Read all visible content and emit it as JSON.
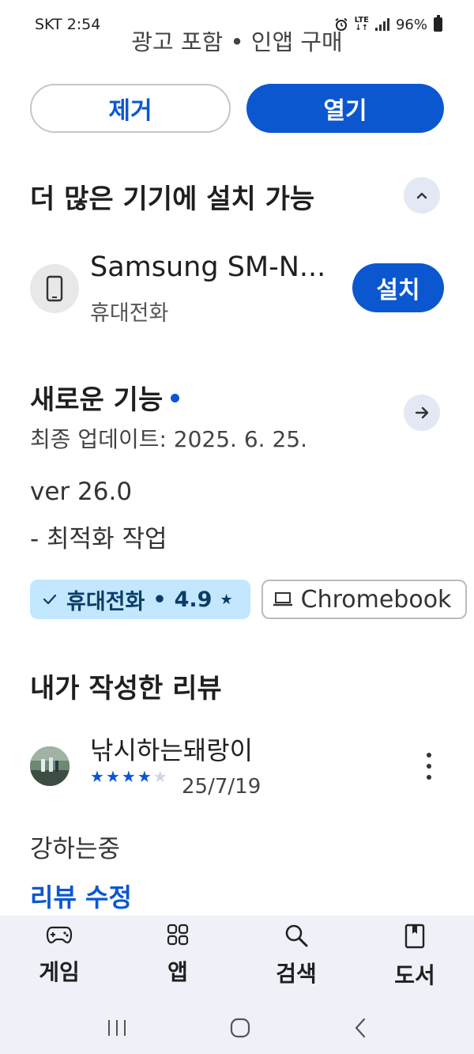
{
  "status_bar": {
    "carrier_time": "SKT 2:54",
    "network": "LTE",
    "battery": "96%"
  },
  "top": {
    "clipped_text": "광고 포함 • 인앱 구매"
  },
  "actions": {
    "uninstall_label": "제거",
    "open_label": "열기"
  },
  "more_devices": {
    "title": "더 많은 기기에 설치 가능",
    "device_name": "Samsung SM-N...",
    "device_type": "휴대전화",
    "install_label": "설치"
  },
  "whats_new": {
    "title": "새로운 기능",
    "last_updated": "최종 업데이트: 2025. 6. 25.",
    "version": "ver 26.0",
    "note": "- 최적화 작업"
  },
  "chips": {
    "phone": {
      "label": "휴대전화",
      "rating": "4.9"
    },
    "chromebook": {
      "label": "Chromebook"
    }
  },
  "my_review": {
    "title": "내가 작성한 리뷰",
    "reviewer": "낚시하는돼랑이",
    "rating": 4,
    "max_rating": 5,
    "date": "25/7/19",
    "text": "강하는중",
    "edit_label": "리뷰 수정"
  },
  "bottom_nav": [
    {
      "label": "게임",
      "icon": "gamepad-icon"
    },
    {
      "label": "앱",
      "icon": "apps-grid-icon"
    },
    {
      "label": "검색",
      "icon": "search-icon"
    },
    {
      "label": "도서",
      "icon": "book-icon"
    }
  ],
  "colors": {
    "accent": "#0b57d0",
    "chip_selected": "#c2e7ff",
    "nav_bg": "#eef1f8"
  }
}
